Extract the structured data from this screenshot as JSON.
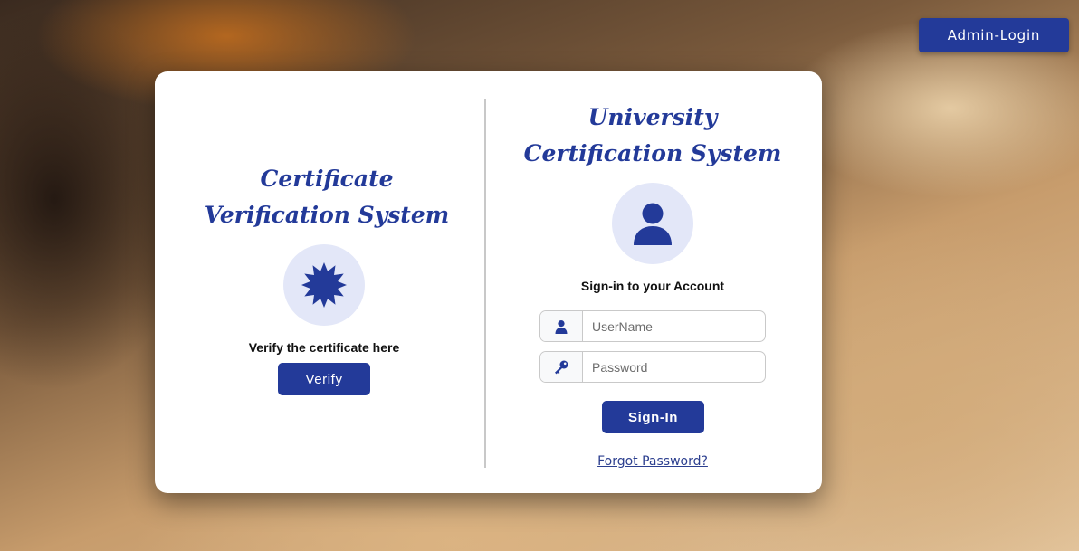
{
  "header": {
    "admin_login_label": "Admin-Login"
  },
  "verify_panel": {
    "title": "Certificate Verification System",
    "icon": "certificate-badge-icon",
    "caption": "Verify the certificate here",
    "verify_button_label": "Verify"
  },
  "signin_panel": {
    "title": "University Certification System",
    "icon": "user-avatar-icon",
    "caption": "Sign-in to your Account",
    "username": {
      "placeholder": "UserName",
      "value": "",
      "icon": "user-icon"
    },
    "password": {
      "placeholder": "Password",
      "value": "",
      "icon": "key-icon"
    },
    "signin_button_label": "Sign-In",
    "forgot_password_label": "Forgot Password?"
  },
  "colors": {
    "primary": "#233a99",
    "icon_circle_bg": "#e3e7f8",
    "card_bg": "#ffffff"
  }
}
